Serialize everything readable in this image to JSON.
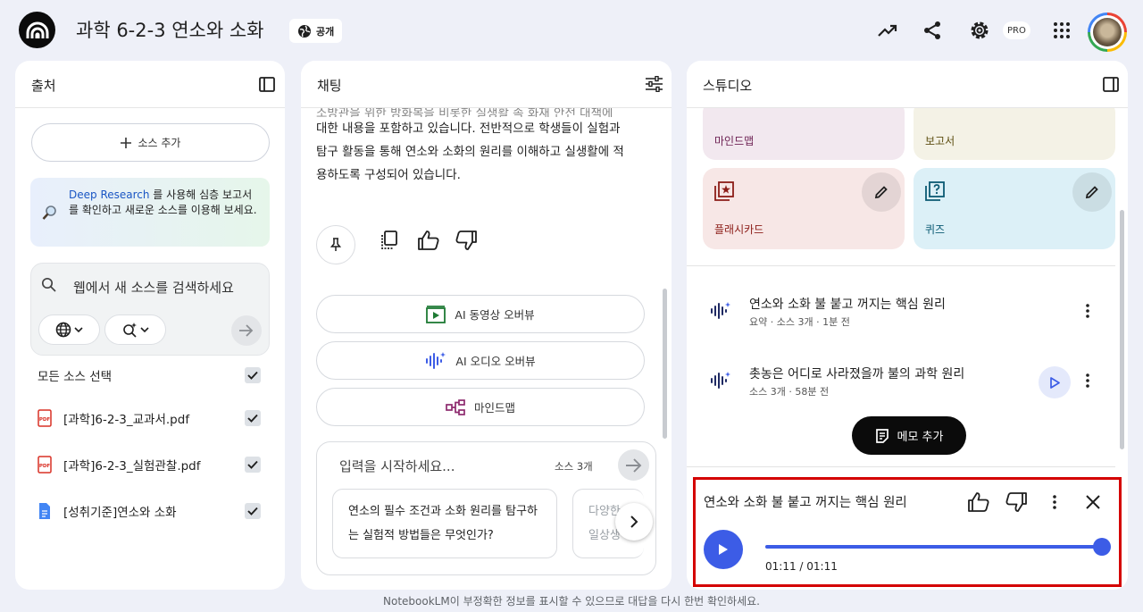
{
  "header": {
    "title": "과학 6-2-3 연소와 소화",
    "public_label": "공개",
    "pro_badge": "PRO"
  },
  "sources": {
    "panel_title": "출처",
    "add_button": "소스 추가",
    "deep_research_link": "Deep Research",
    "deep_research_text": " 를 사용해 심층 보고서를 확인하고 새로운 소스를 이용해 보세요.",
    "search_placeholder": "웹에서 새 소스를 검색하세요",
    "select_all_label": "모든 소스 선택",
    "items": [
      {
        "name": "[과학]6-2-3_교과서.pdf",
        "type": "pdf"
      },
      {
        "name": "[과학]6-2-3_실험관찰.pdf",
        "type": "pdf"
      },
      {
        "name": "[성취기준]연소와 소화",
        "type": "doc"
      }
    ]
  },
  "chat": {
    "panel_title": "채팅",
    "partial_line": "소방관을 위한 방화복을 비롯한 실생활 속 화재 안전 대책에",
    "line1": "대한 내용을 포함하고 있습니다. 전반적으로 학생들이 실험과",
    "line2": "탐구 활동을 통해 연소와 소화의 원리를 이해하고 실생활에 적",
    "line3": "용하도록 구성되어 있습니다.",
    "overview_buttons": [
      "AI 동영상 오버뷰",
      "AI 오디오 오버뷰",
      "마인드맵"
    ],
    "input_placeholder": "입력을 시작하세요...",
    "source_count": "소스 3개",
    "suggestions": [
      "연소의 필수 조건과 소화 원리를 탐구하는 실험적 방법들은 무엇인가?",
      "다양한 소화 방법이 일상생활"
    ],
    "suggestion_visible_2a": "다양한",
    "suggestion_visible_2b": "일상생"
  },
  "studio": {
    "panel_title": "스튜디오",
    "tiles": [
      {
        "label": "마인드맵",
        "color": "#f2e8ef"
      },
      {
        "label": "보고서",
        "color": "#f4f2e6"
      },
      {
        "label": "플래시카드",
        "color": "#f7e7e6"
      },
      {
        "label": "퀴즈",
        "color": "#dcf0f7"
      }
    ],
    "notes": [
      {
        "title": "연소와 소화 불 붙고 꺼지는 핵심 원리",
        "sub": "요약 · 소스 3개 · 1분 전"
      },
      {
        "title": "촛농은 어디로 사라졌을까 불의 과학 원리",
        "sub": "소스 3개 · 58분 전"
      }
    ],
    "memo_button": "메모 추가"
  },
  "player": {
    "title": "연소와 소화 불 붙고 꺼지는 핵심 원리",
    "time": "01:11 / 01:11",
    "progress": 1.0
  },
  "footer": "NotebookLM이 부정확한 정보를 표시할 수 있으므로 대답을 다시 한번 확인하세요.",
  "colors": {
    "accent": "#3c5ce6",
    "highlight_border": "#d40000"
  }
}
